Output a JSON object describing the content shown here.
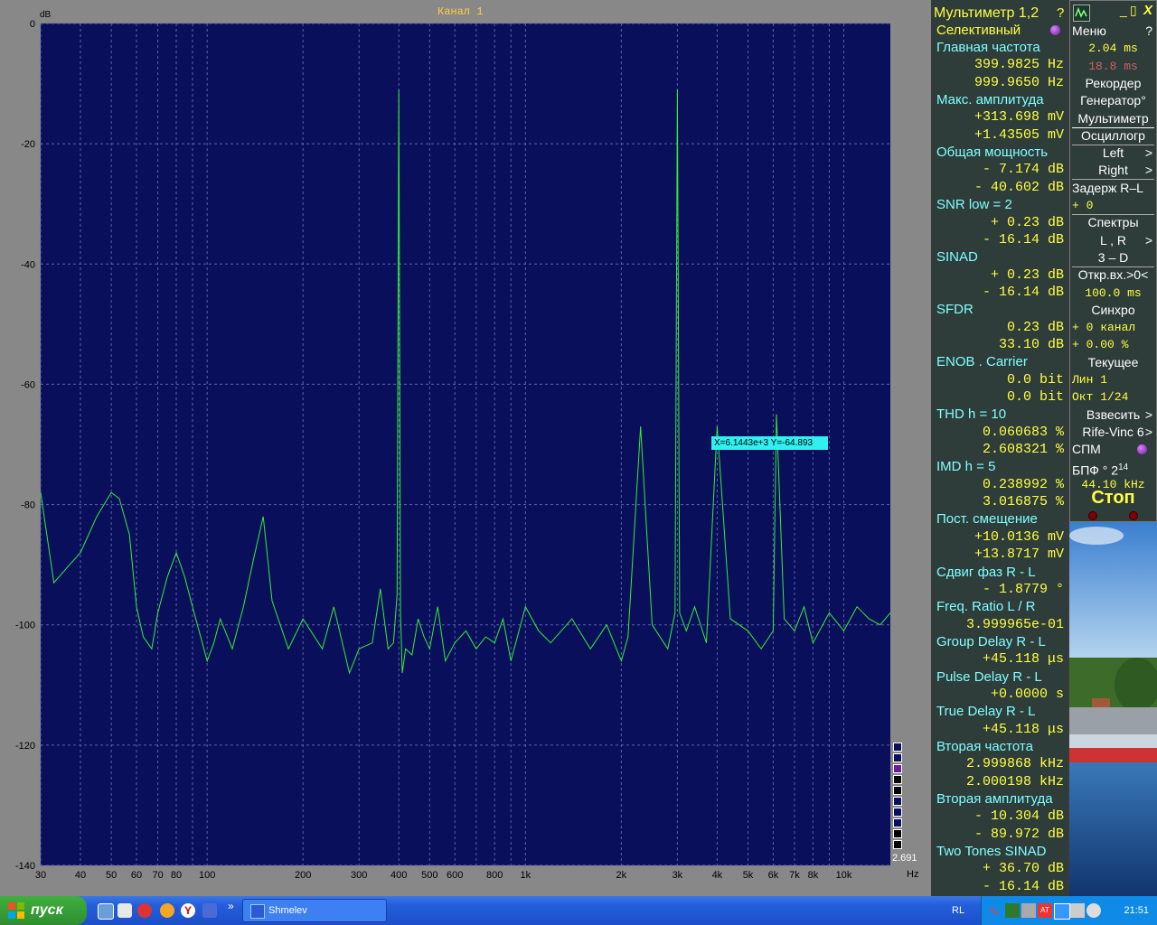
{
  "plot": {
    "channel_title": "Канал 1",
    "y_unit": "dB",
    "x_unit": "Hz",
    "corner_value": "2.691",
    "y_ticks": [
      "0",
      "-20",
      "-40",
      "-60",
      "-80",
      "-100",
      "-120",
      "-140"
    ],
    "x_ticks": [
      "30",
      "40",
      "50",
      "60",
      "70",
      "80",
      "100",
      "200",
      "300",
      "400",
      "500",
      "600",
      "800",
      "1k",
      "2k",
      "3k",
      "4k",
      "5k",
      "6k",
      "7k",
      "8k",
      "10k"
    ],
    "tooltip": "X=6.1443e+3   Y=-64.893",
    "colors": {
      "background": "#0a0f5c",
      "grid": "#5a63a8",
      "trace": "#33ee33",
      "frame": "#888888"
    }
  },
  "chart_data": {
    "type": "line",
    "title": "Канал 1",
    "xlabel": "Hz",
    "ylabel": "dB",
    "x_scale": "log",
    "xlim": [
      30,
      14000
    ],
    "ylim": [
      -140,
      0
    ],
    "series": [
      {
        "x": [
          30,
          33,
          37,
          40,
          45,
          50,
          53,
          57,
          60,
          63,
          67,
          70,
          75,
          80,
          85,
          90,
          100,
          105,
          110,
          120,
          130,
          140,
          150,
          160,
          180,
          200,
          230,
          250,
          280,
          300,
          330,
          350,
          370,
          385,
          395,
          400,
          405,
          410,
          420,
          440,
          460,
          480,
          500,
          530,
          560,
          600,
          650,
          700,
          750,
          800,
          850,
          900,
          1000,
          1100,
          1200,
          1400,
          1600,
          1800,
          2000,
          2100,
          2300,
          2500,
          2800,
          2950,
          3000,
          3050,
          3200,
          3400,
          3700,
          4000,
          4400,
          5000,
          5500,
          6000,
          6144,
          6500,
          7000,
          7500,
          8000,
          9000,
          10000,
          11000,
          12000,
          13000,
          14000
        ],
        "values": [
          -78,
          -93,
          -90,
          -88,
          -82,
          -78,
          -79,
          -85,
          -97,
          -102,
          -104,
          -98,
          -92,
          -88,
          -92,
          -97,
          -106,
          -103,
          -99,
          -104,
          -97,
          -89,
          -82,
          -96,
          -104,
          -99,
          -104,
          -97,
          -108,
          -104,
          -103,
          -94,
          -104,
          -103,
          -95,
          -11,
          -98,
          -108,
          -104,
          -105,
          -99,
          -102,
          -104,
          -97,
          -106,
          -103,
          -101,
          -104,
          -102,
          -103,
          -99,
          -106,
          -97,
          -101,
          -103,
          -99,
          -104,
          -100,
          -106,
          -102,
          -67,
          -100,
          -104,
          -98,
          -11,
          -98,
          -101,
          -97,
          -103,
          -67,
          -99,
          -101,
          -104,
          -101,
          -65,
          -99,
          -101,
          -97,
          -103,
          -98,
          -101,
          -97,
          -99,
          -100,
          -98
        ]
      }
    ],
    "annotations": [
      "X=6.1443e+3   Y=-64.893"
    ]
  },
  "multimeter": {
    "title": "Мультиметр 1,2",
    "help": "?",
    "mode": "Селективный",
    "rows": [
      {
        "k": "h",
        "t": "Главная частота"
      },
      {
        "k": "v",
        "t": "399.9825  Hz"
      },
      {
        "k": "v",
        "t": "999.9650  Hz"
      },
      {
        "k": "h",
        "t": "Макс. амплитуда"
      },
      {
        "k": "v",
        "t": "+313.698 mV"
      },
      {
        "k": "v",
        "t": "+1.43505 mV"
      },
      {
        "k": "h",
        "t": "Общая мощность"
      },
      {
        "k": "v",
        "t": "-   7.174 dB"
      },
      {
        "k": "v",
        "t": "-  40.602 dB"
      },
      {
        "k": "h",
        "t": "SNR      low =     2"
      },
      {
        "k": "v",
        "t": "+   0.23 dB"
      },
      {
        "k": "v",
        "t": "-  16.14 dB"
      },
      {
        "k": "h",
        "t": "SINAD"
      },
      {
        "k": "v",
        "t": "+   0.23 dB"
      },
      {
        "k": "v",
        "t": "-  16.14 dB"
      },
      {
        "k": "h",
        "t": "SFDR"
      },
      {
        "k": "v",
        "t": "0.23 dB"
      },
      {
        "k": "v",
        "t": "33.10 dB"
      },
      {
        "k": "h",
        "t": "ENOB . Carrier"
      },
      {
        "k": "v",
        "t": "0.0 bit"
      },
      {
        "k": "v",
        "t": "0.0 bit"
      },
      {
        "k": "h",
        "t": "THD       h =    10"
      },
      {
        "k": "v",
        "t": "0.060683 %"
      },
      {
        "k": "v",
        "t": "2.608321 %"
      },
      {
        "k": "h",
        "t": "IMD       h =     5"
      },
      {
        "k": "v",
        "t": "0.238992 %"
      },
      {
        "k": "v",
        "t": "3.016875 %"
      },
      {
        "k": "h",
        "t": "Пост. смещение"
      },
      {
        "k": "v",
        "t": "+10.0136 mV"
      },
      {
        "k": "v",
        "t": "+13.8717 mV"
      },
      {
        "k": "h",
        "t": "Сдвиг фаз R - L"
      },
      {
        "k": "v",
        "t": "-   1.8779 °"
      },
      {
        "k": "h",
        "t": "Freq. Ratio  L / R"
      },
      {
        "k": "v",
        "t": "3.999965e-01"
      },
      {
        "k": "h",
        "t": "Group Delay R - L"
      },
      {
        "k": "v",
        "t": "+45.118 μs"
      },
      {
        "k": "h",
        "t": "Pulse Delay R - L"
      },
      {
        "k": "v",
        "t": "+0.0000  s"
      },
      {
        "k": "h",
        "t": "True  Delay R - L"
      },
      {
        "k": "v",
        "t": "+45.118 μs"
      },
      {
        "k": "h",
        "t": "Вторая частота"
      },
      {
        "k": "v",
        "t": "2.999868 kHz"
      },
      {
        "k": "v",
        "t": "2.000198 kHz"
      },
      {
        "k": "h",
        "t": "Вторая амплитуда"
      },
      {
        "k": "v",
        "t": "-  10.304 dB"
      },
      {
        "k": "v",
        "t": "-  89.972 dB"
      },
      {
        "k": "h",
        "t": "Two Tones SINAD"
      },
      {
        "k": "v",
        "t": "+  36.70 dB"
      },
      {
        "k": "v",
        "t": "-  16.14 dB"
      }
    ]
  },
  "menu": {
    "window_controls": {
      "minimize": "_",
      "restore": "▯",
      "close": "X"
    },
    "items": [
      {
        "label": "Меню",
        "extra": "?",
        "style": "w"
      },
      {
        "label": "2.04 ms",
        "style": "mono-c-w"
      },
      {
        "label": "18.8 ms",
        "style": "mono-c-r"
      },
      {
        "label": "Рекордер",
        "style": "c"
      },
      {
        "label": "Генератор°",
        "style": "c"
      },
      {
        "label": "Мультиметр",
        "style": "c"
      },
      {
        "label": "Осциллогр",
        "style": "c"
      },
      {
        "label": "Left",
        "extra": ">",
        "style": "c"
      },
      {
        "label": "Right",
        "extra": ">",
        "style": "c"
      },
      {
        "label": "Задерж  R–L",
        "style": "w"
      },
      {
        "label": "+       0",
        "style": "mono-y"
      },
      {
        "label": "Спектры",
        "style": "c"
      },
      {
        "label": "L , R",
        "extra": ">",
        "style": "c"
      },
      {
        "label": "3 – D",
        "style": "c"
      },
      {
        "label": "Откр.вх.>0<",
        "style": "c"
      },
      {
        "label": "100.0 ms",
        "style": "mono-c-y"
      },
      {
        "label": "Синхро",
        "style": "c"
      },
      {
        "label": "+  0 канал",
        "style": "mono-y"
      },
      {
        "label": "+  0.00 %",
        "style": "mono-y"
      },
      {
        "label": "Текущее",
        "style": "c"
      },
      {
        "label": "Лин       1",
        "style": "mono-y"
      },
      {
        "label": "Окт  1/24",
        "style": "mono-y"
      },
      {
        "label": "Взвесить",
        "extra": ">",
        "style": "c"
      },
      {
        "label": "Rife-Vinc 6",
        "extra": ">",
        "style": "c"
      },
      {
        "label": "СПМ",
        "style": "w"
      },
      {
        "label": "БПФ ° 2",
        "sup": "14",
        "style": "w"
      },
      {
        "label": "44.10 kHz",
        "style": "mono-c-y"
      },
      {
        "label": "Стоп",
        "style": "stop"
      }
    ]
  },
  "taskbar": {
    "start_label": "пуск",
    "task_label": "Shmelev",
    "lang": "RL",
    "clock": "21:51",
    "chevron": "»"
  }
}
